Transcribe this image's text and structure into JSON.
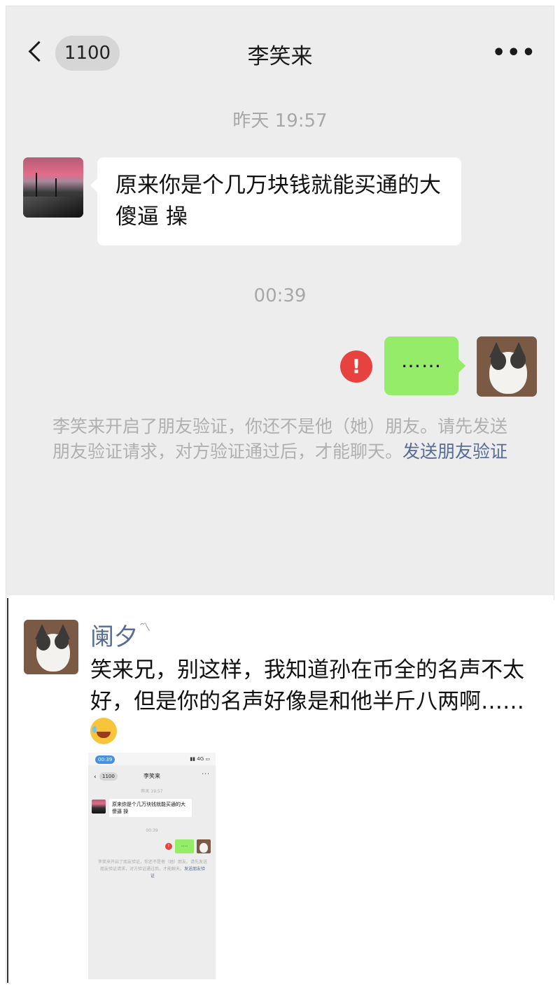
{
  "chat": {
    "header": {
      "back_count": "1100",
      "title": "李笑来",
      "more": "•••"
    },
    "timestamps": [
      "昨天 19:57",
      "00:39"
    ],
    "incoming_message": "原来你是个几万块钱就能买通的大傻逼 操",
    "outgoing_message": "……",
    "error_icon": "!",
    "system_notice": {
      "text": "李笑来开启了朋友验证，你还不是他（她）朋友。请先发送朋友验证请求，对方验证通过后，才能聊天。",
      "link": "发送朋友验证"
    }
  },
  "comment": {
    "username": "阑夕",
    "text": "笑来兄，别这样，我知道孙在币全的名声不太好，但是你的名声好像是和他半斤八两啊……",
    "emoji": "laughing-crying-face-icon"
  },
  "thumbnail": {
    "status_time": "00:39",
    "signal": "4G",
    "back_count": "1100",
    "title": "李笑来",
    "timestamps": [
      "昨天 19:57",
      "00:39"
    ],
    "incoming_message": "原来你是个几万块钱就能买通的大傻逼 操",
    "outgoing_message": "……",
    "system_notice": "李笑来开启了朋友验证，你还不是他（她）朋友。请先发送朋友验证请求，对方验证通过后，才能聊天。",
    "link": "发送朋友验证"
  },
  "colors": {
    "chat_bg": "#ededed",
    "outgoing_bubble": "#95ec69",
    "error_red": "#e64340",
    "link_blue": "#576b95"
  }
}
